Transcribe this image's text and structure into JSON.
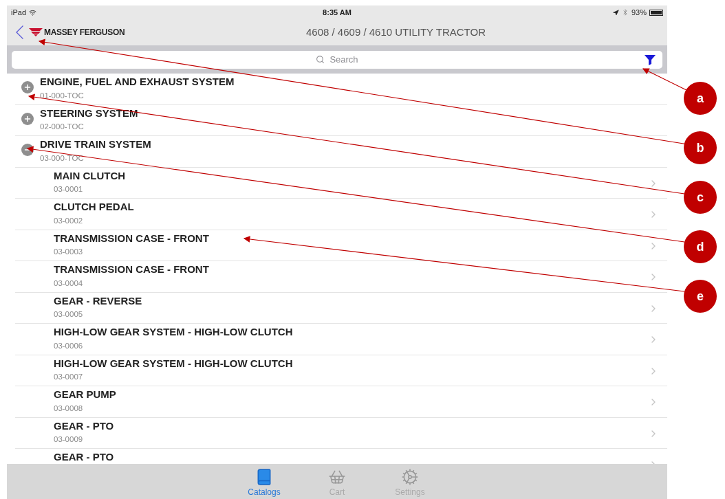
{
  "status_bar": {
    "device": "iPad",
    "time": "8:35 AM",
    "battery": "93%"
  },
  "nav_bar": {
    "brand": "MASSEY FERGUSON",
    "title": "4608 / 4609 / 4610 UTILITY TRACTOR"
  },
  "search": {
    "placeholder": "Search"
  },
  "sections": [
    {
      "title": "ENGINE, FUEL AND EXHAUST SYSTEM",
      "code": "01-000-TOC",
      "expanded": false
    },
    {
      "title": "STEERING SYSTEM",
      "code": "02-000-TOC",
      "expanded": false
    },
    {
      "title": "DRIVE TRAIN SYSTEM",
      "code": "03-000-TOC",
      "expanded": true,
      "children": [
        {
          "title": "MAIN CLUTCH",
          "code": "03-0001"
        },
        {
          "title": "CLUTCH PEDAL",
          "code": "03-0002"
        },
        {
          "title": "TRANSMISSION CASE - FRONT",
          "code": "03-0003"
        },
        {
          "title": "TRANSMISSION CASE - FRONT",
          "code": "03-0004"
        },
        {
          "title": "GEAR - REVERSE",
          "code": "03-0005"
        },
        {
          "title": "HIGH-LOW GEAR SYSTEM - HIGH-LOW CLUTCH",
          "code": "03-0006"
        },
        {
          "title": "HIGH-LOW GEAR SYSTEM - HIGH-LOW CLUTCH",
          "code": "03-0007"
        },
        {
          "title": "GEAR PUMP",
          "code": "03-0008"
        },
        {
          "title": "GEAR - PTO",
          "code": "03-0009"
        },
        {
          "title": "GEAR - PTO"
        }
      ]
    }
  ],
  "tab_bar": [
    {
      "label": "Catalogs",
      "selected": true
    },
    {
      "label": "Cart",
      "selected": false
    },
    {
      "label": "Settings",
      "selected": false
    }
  ],
  "callouts": [
    "a",
    "b",
    "c",
    "d",
    "e"
  ]
}
